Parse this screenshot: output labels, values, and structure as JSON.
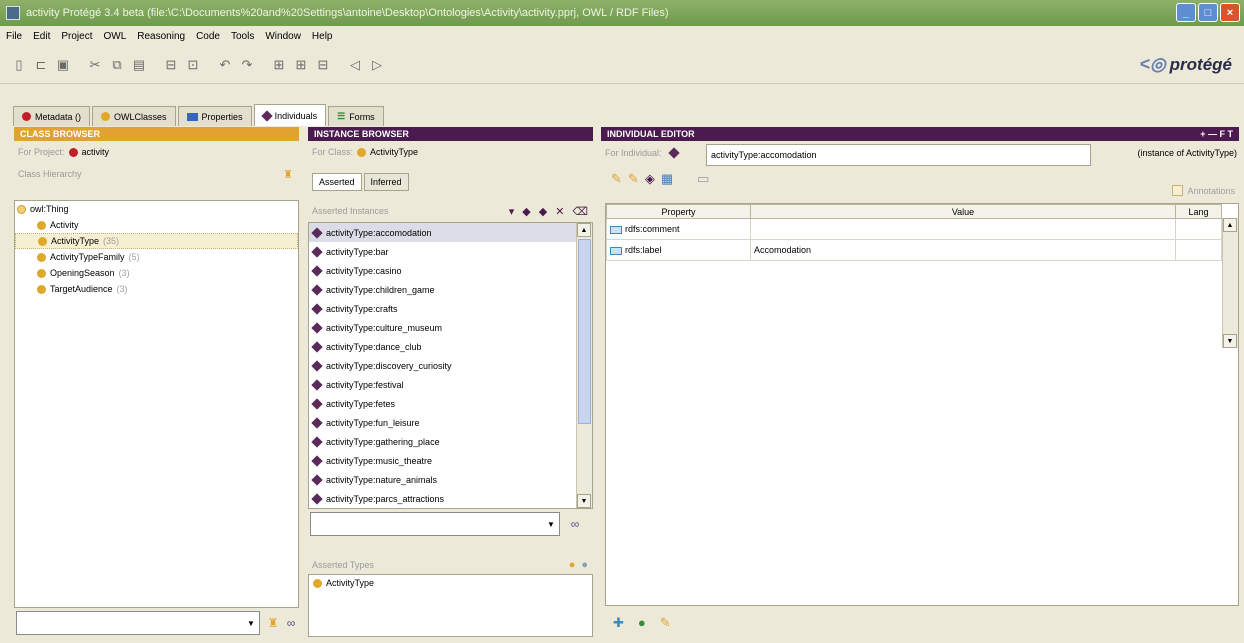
{
  "window": {
    "title": "activity Protégé 3.4 beta  (file:\\C:\\Documents%20and%20Settings\\antoine\\Desktop\\Ontologies\\Activity\\activity.pprj, OWL / RDF Files)"
  },
  "menu": [
    "File",
    "Edit",
    "Project",
    "OWL",
    "Reasoning",
    "Code",
    "Tools",
    "Window",
    "Help"
  ],
  "toolbar": {
    "icons": [
      "new-file-icon",
      "open-file-icon",
      "save-icon",
      "cut-icon",
      "copy-icon",
      "paste-icon",
      "archive-icon",
      "export-icon",
      "undo-icon",
      "redo-icon",
      "search-icon",
      "zoom-icon",
      "zoom-out-icon",
      "back-icon",
      "forward-icon"
    ],
    "logo": "protégé"
  },
  "tabs": [
    {
      "label": "Metadata ()",
      "icon": "red-dot"
    },
    {
      "label": "OWLClasses",
      "icon": "yellow-dot"
    },
    {
      "label": "Properties",
      "icon": "blue-square"
    },
    {
      "label": "Individuals",
      "icon": "purple-diamond",
      "active": true
    },
    {
      "label": "Forms",
      "icon": "forms"
    }
  ],
  "class_browser": {
    "header": "CLASS BROWSER",
    "for_project_label": "For Project:",
    "project_name": "activity",
    "hierarchy_label": "Class Hierarchy",
    "root": "owl:Thing",
    "items": [
      {
        "name": "Activity",
        "count": ""
      },
      {
        "name": "ActivityType",
        "count": "(35)",
        "selected": true
      },
      {
        "name": "ActivityTypeFamily",
        "count": "(5)"
      },
      {
        "name": "OpeningSeason",
        "count": "(3)"
      },
      {
        "name": "TargetAudience",
        "count": "(3)"
      }
    ]
  },
  "instance_browser": {
    "header": "INSTANCE BROWSER",
    "for_class_label": "For Class:",
    "class_name": "ActivityType",
    "tab_asserted": "Asserted",
    "tab_inferred": "Inferred",
    "instances_label": "Asserted Instances",
    "instances": [
      "activityType:accomodation",
      "activityType:bar",
      "activityType:casino",
      "activityType:children_game",
      "activityType:crafts",
      "activityType:culture_museum",
      "activityType:dance_club",
      "activityType:discovery_curiosity",
      "activityType:festival",
      "activityType:fetes",
      "activityType:fun_leisure",
      "activityType:gathering_place",
      "activityType:music_theatre",
      "activityType:nature_animals",
      "activityType:parcs_attractions"
    ],
    "types_label": "Asserted Types",
    "types": [
      "ActivityType"
    ]
  },
  "individual_editor": {
    "header": "INDIVIDUAL EDITOR",
    "header_controls": "+ — F T",
    "for_individual_label": "For Individual:",
    "individual_name": "activityType:accomodation",
    "instance_of": "(instance of ActivityType)",
    "annotations_label": "Annotations",
    "columns": [
      "Property",
      "Value",
      "Lang"
    ],
    "rows": [
      {
        "property": "rdfs:comment",
        "value": "",
        "lang": ""
      },
      {
        "property": "rdfs:label",
        "value": "Accomodation",
        "lang": ""
      }
    ]
  }
}
